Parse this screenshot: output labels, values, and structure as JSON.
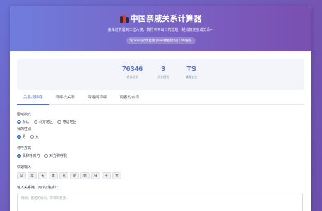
{
  "hero": {
    "title": "中国亲戚关系计算器",
    "subtitle": "逢年过节遇到三姑六婆，搞得叫不出口的尴尬！轻松搞定亲戚关系～",
    "badge": "TypeScript 优化版 | Map数据结构 | LRU缓存"
  },
  "stats": [
    {
      "value": "76346",
      "label": "收录关系"
    },
    {
      "value": "3",
      "label": "方言模式"
    },
    {
      "value": "TS",
      "label": "类型安全"
    }
  ],
  "tabs": [
    {
      "label": "关系找称呼",
      "active": true
    },
    {
      "label": "称呼找关系",
      "active": false
    },
    {
      "label": "两者间称呼",
      "active": false
    },
    {
      "label": "两者的合称",
      "active": false
    }
  ],
  "region": {
    "label": "区域模式：",
    "options": [
      {
        "label": "默认",
        "selected": true
      },
      {
        "label": "北方地区",
        "selected": false
      },
      {
        "label": "粤语地区",
        "selected": false
      }
    ]
  },
  "gender": {
    "label": "我的性别：",
    "options": [
      {
        "label": "男",
        "selected": true
      },
      {
        "label": "女",
        "selected": false
      }
    ]
  },
  "call_mode": {
    "label": "称呼方式：",
    "options": [
      {
        "label": "我称呼对方",
        "selected": true
      },
      {
        "label": "对方称呼我",
        "selected": false
      }
    ]
  },
  "quick_input": {
    "label": "快速输入：",
    "buttons": [
      "父",
      "母",
      "夫",
      "妻",
      "兄",
      "弟",
      "姐",
      "妹",
      "子",
      "女"
    ]
  },
  "relation_input": {
    "label": "输入关系链（用\"的\"连接）：",
    "placeholder": "例如：爸爸的妈妈、哥哥的老婆..."
  },
  "colors": {
    "accent": "#5a6fc4",
    "radio_selected": "#2f6fe0",
    "background_start": "#6a73d6",
    "background_end": "#7455b4"
  }
}
